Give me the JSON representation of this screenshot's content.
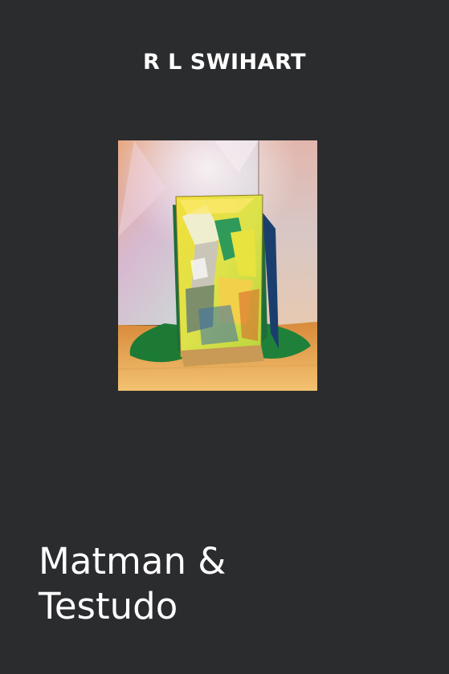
{
  "cover": {
    "author": "R L SWIHART",
    "title_lines": [
      "Matman &",
      "Testudo"
    ],
    "background_color": "#2b2c2e",
    "text_color": "#ffffff",
    "image": {
      "subject": "photograph of a colorful mixed-media panel draped with green fabric standing in a gallery corner",
      "icon": "artwork-photo"
    }
  }
}
